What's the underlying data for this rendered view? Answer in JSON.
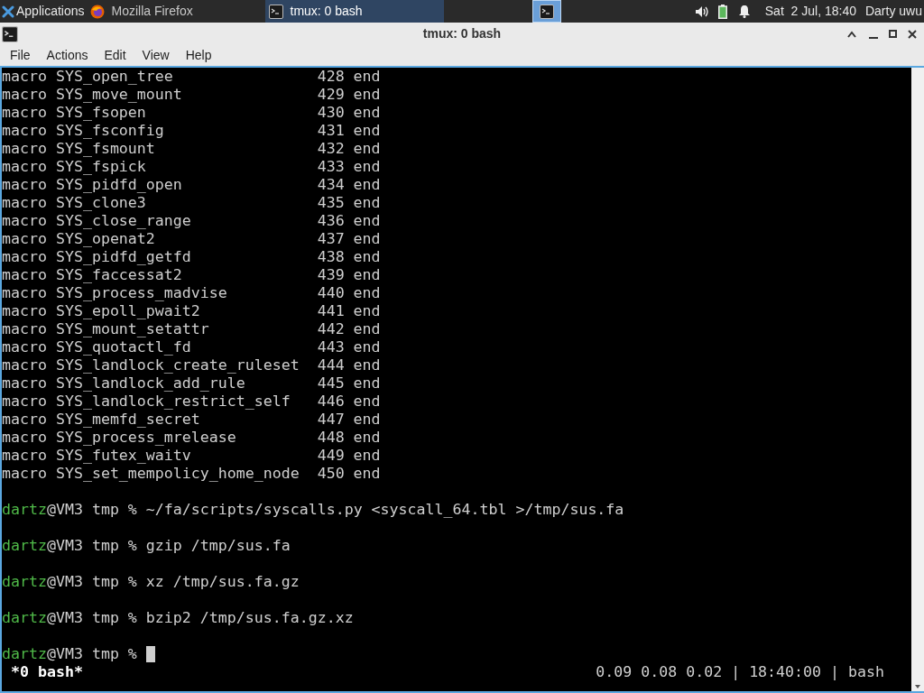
{
  "panel": {
    "apps_menu": "Applications",
    "tasks": [
      {
        "label": "Mozilla Firefox",
        "kind": "browser",
        "selected": false
      },
      {
        "label": "tmux: 0 bash",
        "kind": "terminal",
        "selected": true
      }
    ],
    "workspaces": [
      {
        "selected": true
      }
    ],
    "clock": "Sat  2 Jul, 18:40",
    "user": "Darty uwu"
  },
  "window": {
    "title": "tmux: 0 bash",
    "menu": [
      "File",
      "Actions",
      "Edit",
      "View",
      "Help"
    ]
  },
  "terminal": {
    "output": [
      "macro SYS_open_tree                428 end",
      "macro SYS_move_mount               429 end",
      "macro SYS_fsopen                   430 end",
      "macro SYS_fsconfig                 431 end",
      "macro SYS_fsmount                  432 end",
      "macro SYS_fspick                   433 end",
      "macro SYS_pidfd_open               434 end",
      "macro SYS_clone3                   435 end",
      "macro SYS_close_range              436 end",
      "macro SYS_openat2                  437 end",
      "macro SYS_pidfd_getfd              438 end",
      "macro SYS_faccessat2               439 end",
      "macro SYS_process_madvise          440 end",
      "macro SYS_epoll_pwait2             441 end",
      "macro SYS_mount_setattr            442 end",
      "macro SYS_quotactl_fd              443 end",
      "macro SYS_landlock_create_ruleset  444 end",
      "macro SYS_landlock_add_rule        445 end",
      "macro SYS_landlock_restrict_self   446 end",
      "macro SYS_memfd_secret             447 end",
      "macro SYS_process_mrelease         448 end",
      "macro SYS_futex_waitv              449 end",
      "macro SYS_set_mempolicy_home_node  450 end"
    ],
    "prompts": [
      {
        "user": "dartz",
        "host": "@VM3 tmp %",
        "command": "~/fa/scripts/syscalls.py <syscall_64.tbl >/tmp/sus.fa"
      },
      {
        "user": "dartz",
        "host": "@VM3 tmp %",
        "command": "gzip /tmp/sus.fa"
      },
      {
        "user": "dartz",
        "host": "@VM3 tmp %",
        "command": "xz /tmp/sus.fa.gz"
      },
      {
        "user": "dartz",
        "host": "@VM3 tmp %",
        "command": "bzip2 /tmp/sus.fa.gz.xz"
      },
      {
        "user": "dartz",
        "host": "@VM3 tmp %",
        "cursor": true
      }
    ]
  },
  "tmux_status": {
    "window": "*0 bash*",
    "info": "0.09 0.08 0.02 | 18:40:00 | bash"
  }
}
